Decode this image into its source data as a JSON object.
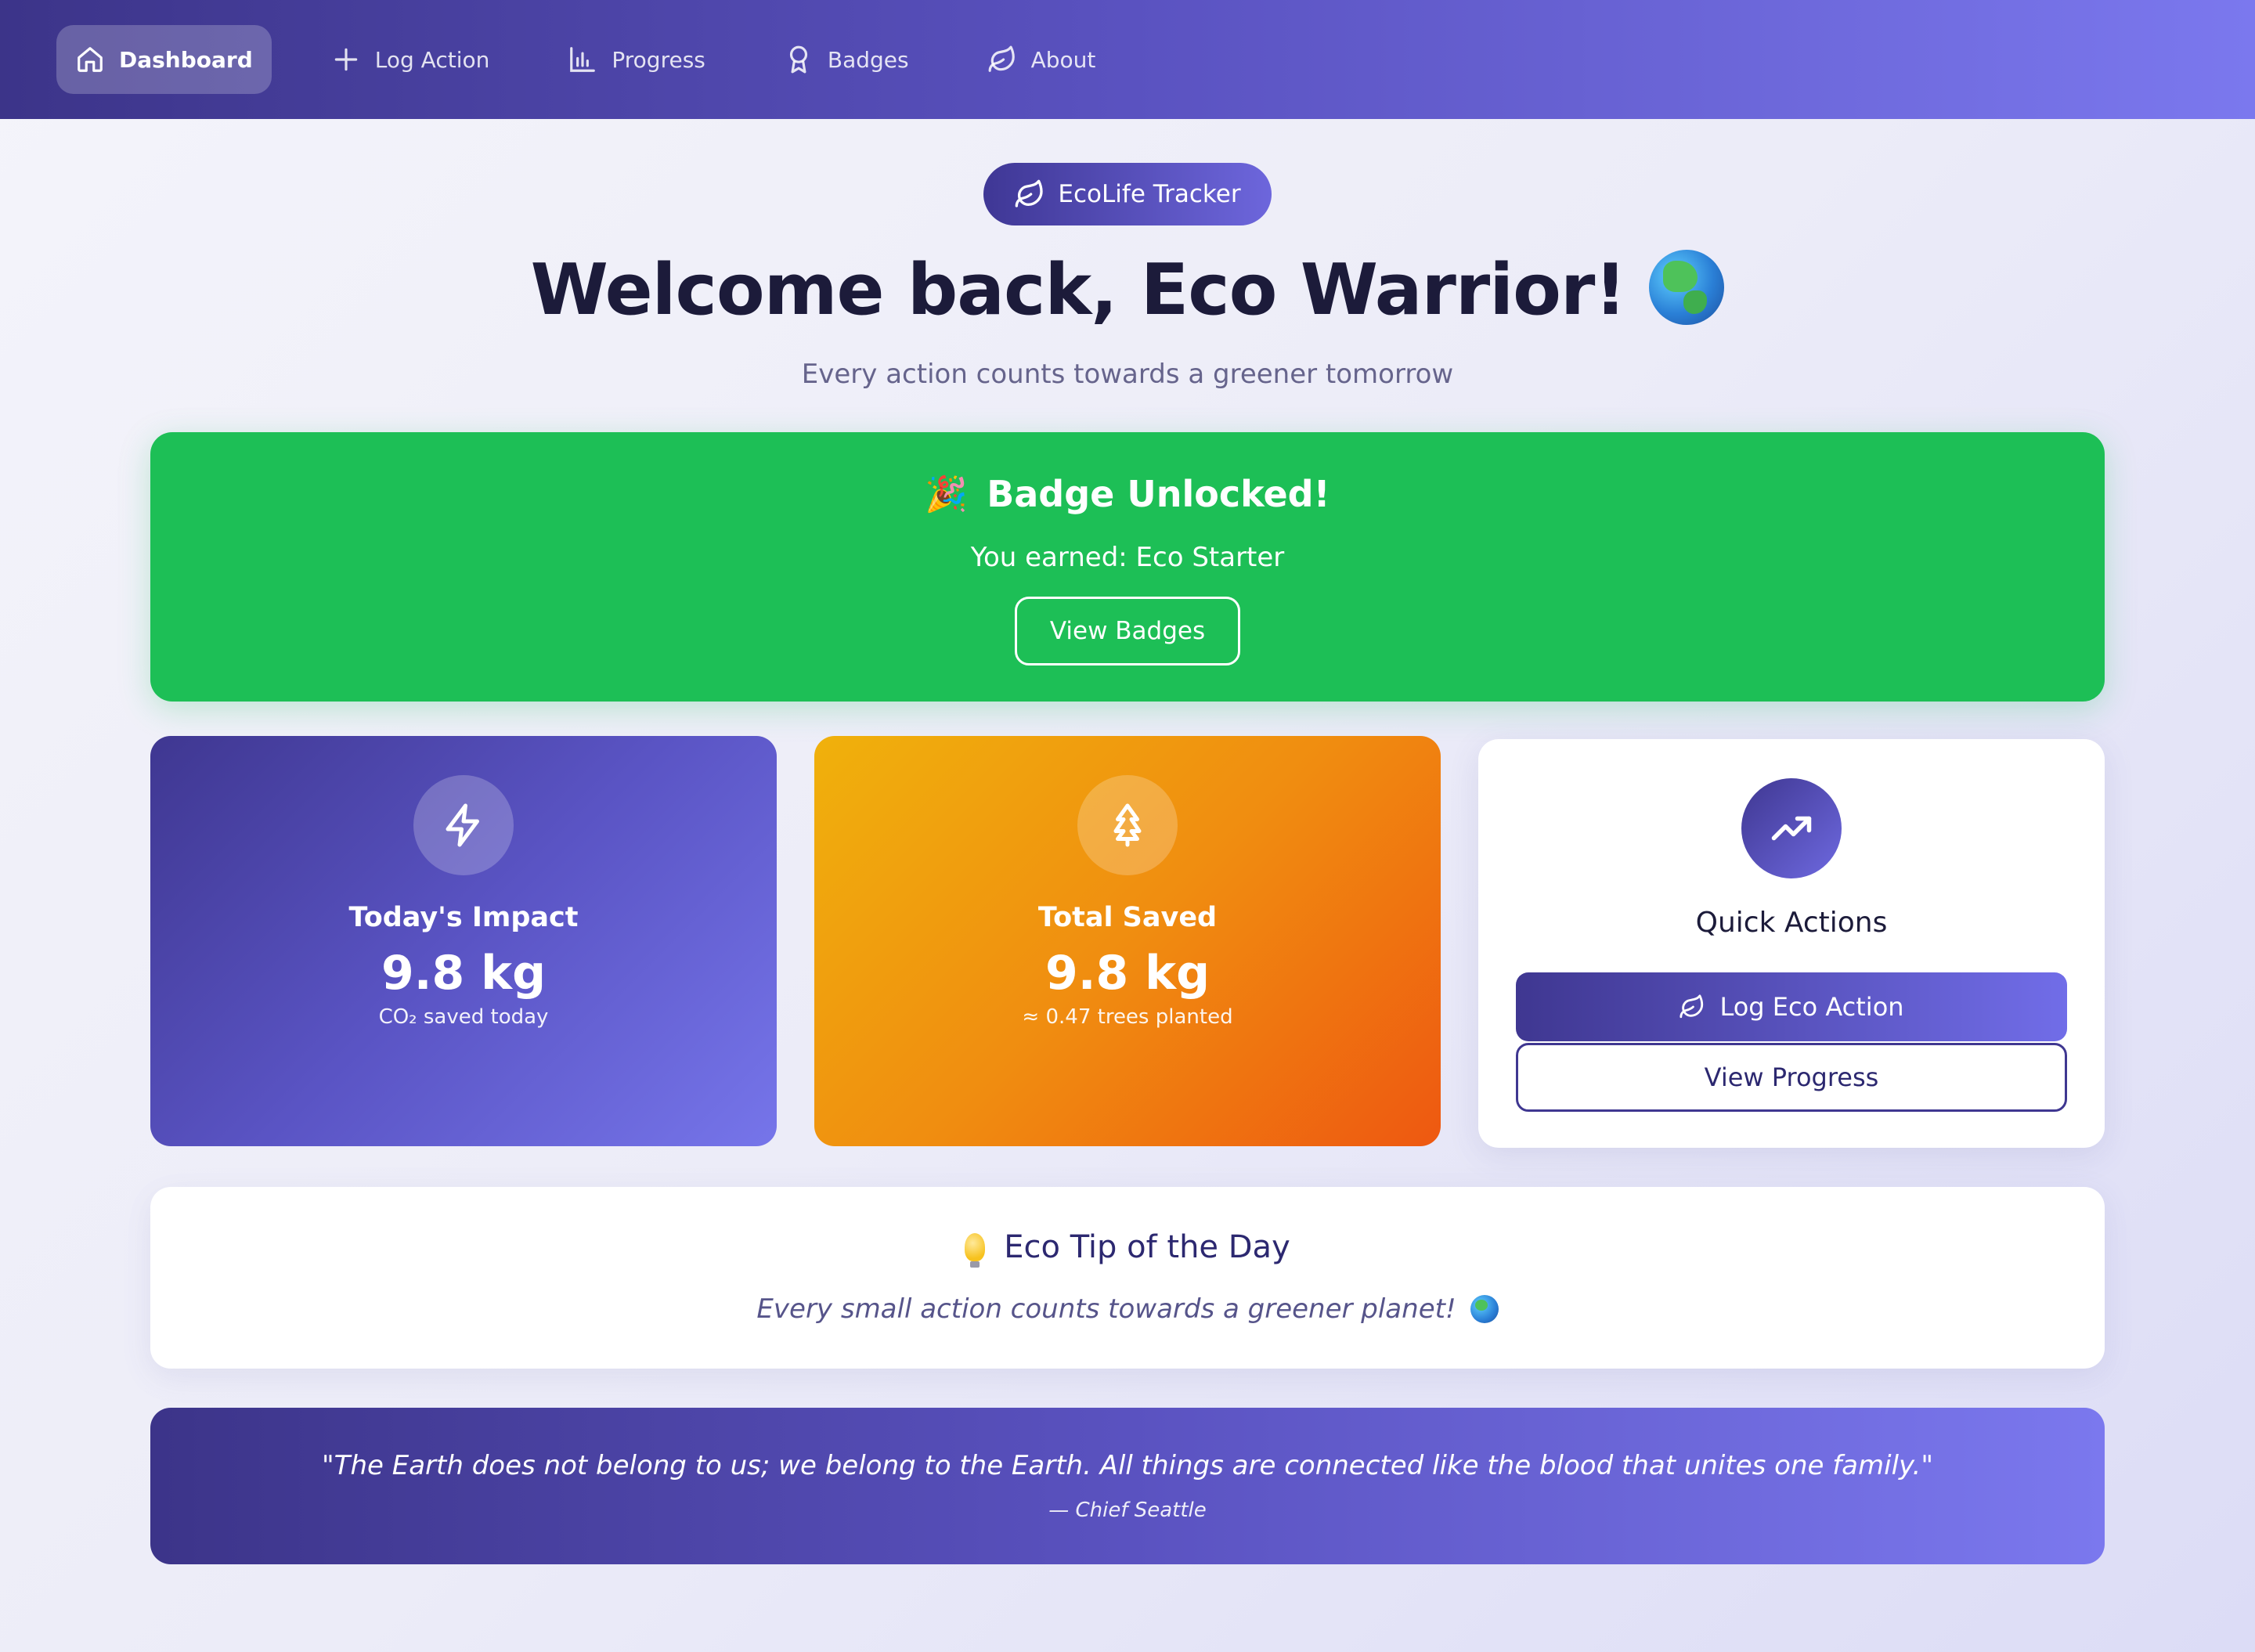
{
  "nav": {
    "items": [
      {
        "label": "Dashboard",
        "icon": "home-icon",
        "active": true
      },
      {
        "label": "Log Action",
        "icon": "plus-icon",
        "active": false
      },
      {
        "label": "Progress",
        "icon": "bar-chart-icon",
        "active": false
      },
      {
        "label": "Badges",
        "icon": "award-icon",
        "active": false
      },
      {
        "label": "About",
        "icon": "leaf-icon",
        "active": false
      }
    ]
  },
  "header": {
    "brand": "EcoLife Tracker",
    "title": "Welcome back, Eco Warrior!",
    "subtitle": "Every action counts towards a greener tomorrow"
  },
  "banner": {
    "title": "Badge Unlocked!",
    "message": "You earned: Eco Starter",
    "button_label": "View Badges"
  },
  "cards": {
    "impact": {
      "title": "Today's Impact",
      "value": "9.8 kg",
      "note": "CO₂ saved today"
    },
    "saved": {
      "title": "Total Saved",
      "value": "9.8 kg",
      "note": "≈ 0.47 trees planted"
    },
    "quick": {
      "title": "Quick Actions",
      "primary_label": "Log Eco Action",
      "secondary_label": "View Progress"
    }
  },
  "tip": {
    "title": "Eco Tip of the Day",
    "text": "Every small action counts towards a greener planet!"
  },
  "quote": {
    "text": "\"The Earth does not belong to us; we belong to the Earth. All things are connected like the blood that unites one family.\"",
    "author": "— Chief Seattle"
  },
  "colors": {
    "accent": "#4a43a8",
    "success": "#1dbf56",
    "warning": "#f08d10"
  }
}
